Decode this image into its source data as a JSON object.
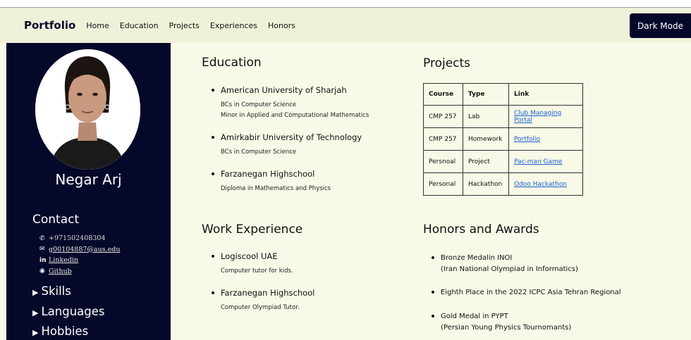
{
  "nav": {
    "brand": "Portfolio",
    "links": [
      "Home",
      "Education",
      "Projects",
      "Experiences",
      "Honors"
    ],
    "dark_mode_label": "Dark Mode"
  },
  "sidebar": {
    "name": "Negar Arj",
    "contact_title": "Contact",
    "contact": {
      "phone": "+971502408304",
      "email": "g00104887@aus.edu",
      "linkedin": "Linkedin",
      "github": "Github"
    },
    "sections": [
      "Skills",
      "Languages",
      "Hobbies"
    ]
  },
  "education": {
    "title": "Education",
    "items": [
      {
        "name": "American University of Sharjah",
        "details": [
          "BCs in Computer Science",
          "Minor in Applied and Computational Mathematics"
        ]
      },
      {
        "name": "Amirkabir University of Technology",
        "details": [
          "BCs in Computer Science"
        ]
      },
      {
        "name": "Farzanegan Highschool",
        "details": [
          "Diploma in Mathematics and Physics"
        ]
      }
    ]
  },
  "work": {
    "title": "Work Experience",
    "items": [
      {
        "name": "Logiscool UAE",
        "details": [
          "Computer tutor for kids."
        ]
      },
      {
        "name": "Farzanegan Highschool",
        "details": [
          "Computer Olympiad Tutor."
        ]
      }
    ]
  },
  "projects": {
    "title": "Projects",
    "headers": [
      "Course",
      "Type",
      "Link"
    ],
    "rows": [
      [
        "CMP 257",
        "Lab",
        "Club Managing Portal"
      ],
      [
        "CMP 257",
        "Homework",
        "Portfolio"
      ],
      [
        "Persnoal",
        "Project",
        "Pac-man Game"
      ],
      [
        "Personal",
        "Hackathon",
        "Odoo Hackathon"
      ]
    ]
  },
  "honors": {
    "title": "Honors and Awards",
    "items": [
      {
        "name": "Bronze Medalin INOI",
        "detail": "(Iran National Olympiad in Informatics)"
      },
      {
        "name": "Eighth Place in the 2022 ICPC Asia Tehran Regional",
        "detail": ""
      },
      {
        "name": "Gold Medal in PYPT",
        "detail": "(Persian Young Physics Tournomants)"
      }
    ]
  },
  "colors": {
    "navy": "#06082a",
    "page_bg": "#f8f9e6",
    "nav_bg": "#eff2d9",
    "link": "#1a5fd6"
  }
}
